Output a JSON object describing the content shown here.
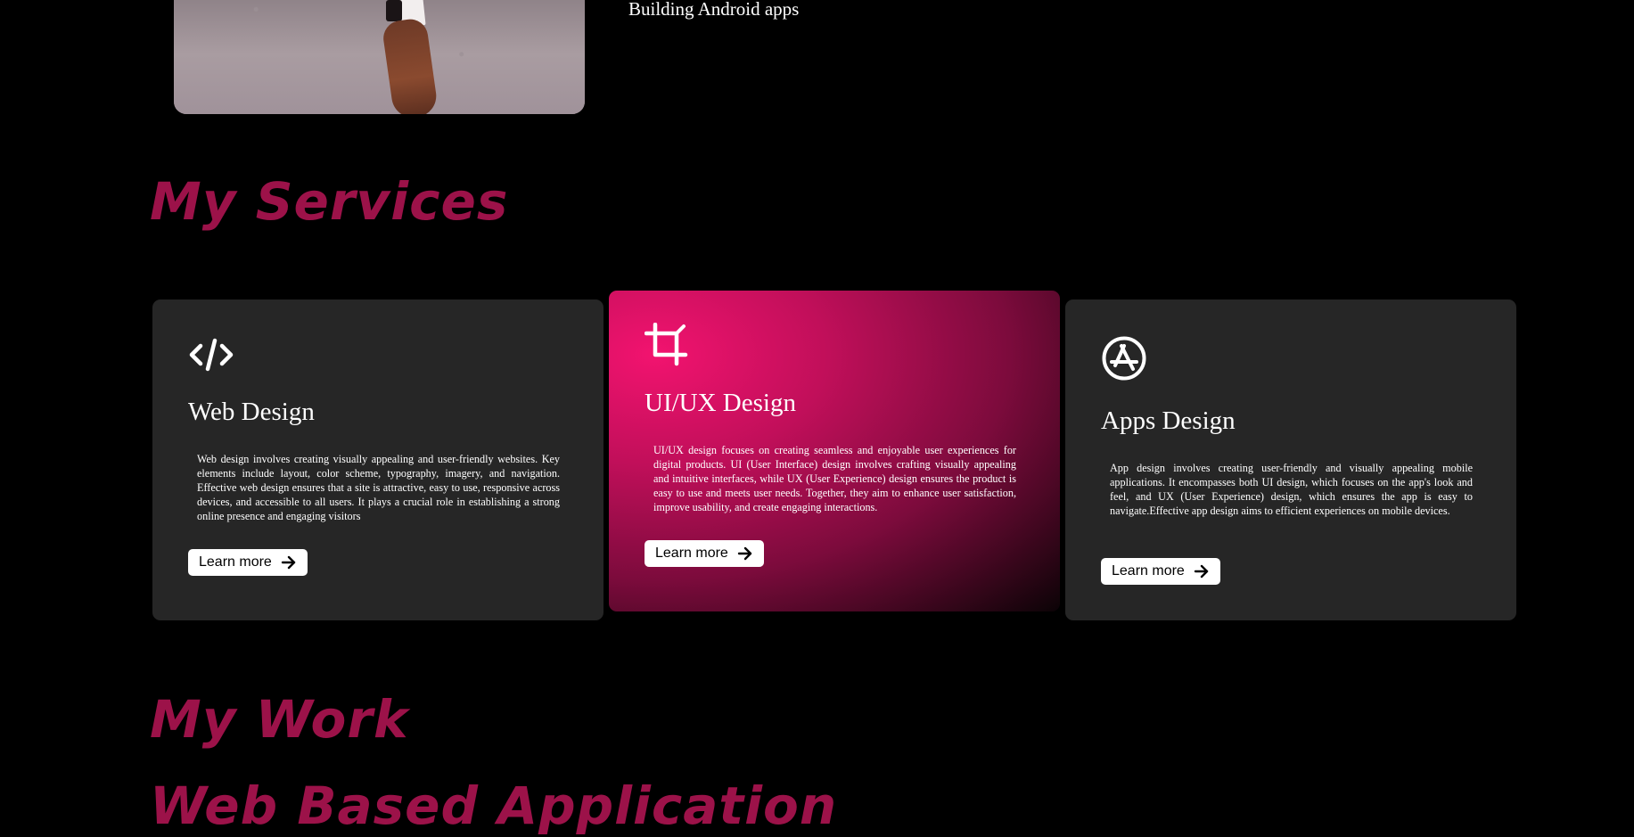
{
  "hero": {
    "tagline": "Building Android apps"
  },
  "services": {
    "heading": "My Services",
    "cards": [
      {
        "title": "Web Design",
        "icon": "code-icon",
        "text": "Web design involves creating visually appealing and user-friendly websites. Key elements include layout, color scheme, typography, imagery, and navigation. Effective web design ensures that a site is attractive, easy to use, responsive across devices, and accessible to all users. It plays a crucial role in establishing a strong online presence and engaging visitors",
        "button": "Learn more"
      },
      {
        "title": "UI/UX Design",
        "icon": "crop-icon",
        "text": "UI/UX design focuses on creating seamless and enjoyable user experiences for digital products. UI (User Interface) design involves crafting visually appealing and intuitive interfaces, while UX (User Experience) design ensures the product is easy to use and meets user needs. Together, they aim to enhance user satisfaction, improve usability, and create engaging interactions.",
        "button": "Learn more"
      },
      {
        "title": "Apps Design",
        "icon": "app-store-icon",
        "text": "App design involves creating user-friendly and visually appealing mobile applications. It encompasses both UI design, which focuses on the app's look and feel, and UX (User Experience) design, which ensures the app is easy to navigate.Effective app design aims to efficient experiences on mobile devices.",
        "button": "Learn more"
      }
    ]
  },
  "work": {
    "heading": "My Work",
    "subheading": "Web Based Application"
  },
  "colors": {
    "background": "#000000",
    "heading": "#9c1249",
    "card": "#262626",
    "accent": "#f2136f"
  }
}
